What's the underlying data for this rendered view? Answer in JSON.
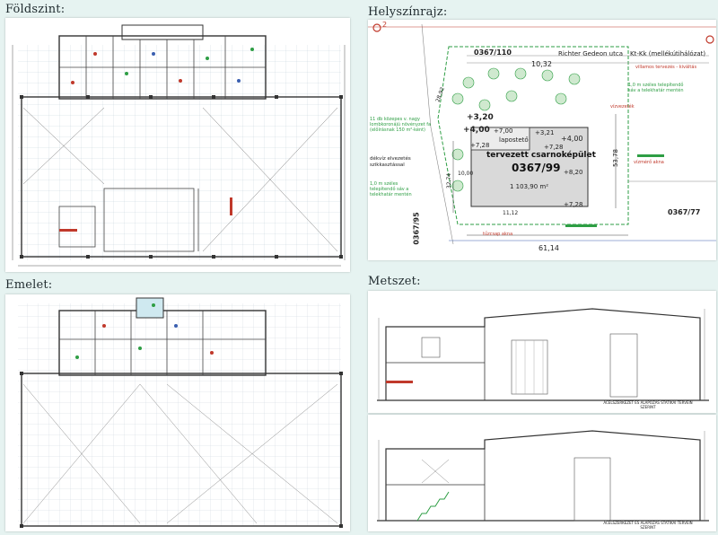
{
  "panels": {
    "ground_floor": {
      "title": "Földszint:"
    },
    "site_plan": {
      "title": "Helyszínrajz:"
    },
    "upper_floor": {
      "title": "Emelet:"
    },
    "section": {
      "title": "Metszet:"
    }
  },
  "site_plan": {
    "building_title": "tervezett csarnoképület",
    "lot_number": "0367/99",
    "area": "1 103,90 m²",
    "street": "Richter Gedeon utca",
    "lot_top": "0367/110",
    "lot_right": "0367/77",
    "lot_left": "0367/95",
    "utility_label": "Kt-Kk (mellékútihálózat)",
    "flat_roof": "lapostető",
    "elev_a": "+3,20",
    "elev_b": "+7,00",
    "elev_c": "+4,00",
    "elev_d": "+3,21",
    "elev_e": "+7,28",
    "elev_f": "+8,20",
    "elev_g": "+4,00",
    "elev_h": "+7,28",
    "elev_i": "+7,28",
    "dim_total": "61,14",
    "dim_side": "53,78",
    "dim_left": "32,74",
    "dim_inner": "10,00",
    "dim_height": "10,32",
    "dim_corner": "28,92",
    "dim_bottom": "11,12",
    "note_trees": "11 db közepes v. nagy lombkoronájú növényzet fa (előírásnak 150 m²-ként)",
    "note_waste": "dékvíz elvezetés szikkasztással",
    "note_strip_left": "1,0 m széles telepítendő sáv a telekhatár mentén",
    "note_strip_right": "1,0 m széles telepítendő sáv a telekhatár mentén",
    "note_util": "villamos tervezés - kiváltás",
    "vonal_1": "vízvezeték",
    "vonal_2": "tűzcsap akna",
    "vonal_3": "vízmérő akna",
    "marker": "2"
  },
  "section": {
    "caption_1": "ACÉLSZERKEZET ÉS ALAPOZÁS STATIKAI TERVEIN SZERINT",
    "caption_2": "ACÉLSZERKEZET ÉS ALAPOZÁS STATIKAI TERVEIN SZERINT"
  },
  "colors": {
    "background": "#e6f3f1",
    "drawing_red": "#c0392b",
    "drawing_green": "#2e9e44",
    "drawing_blue": "#3a5fb0"
  }
}
